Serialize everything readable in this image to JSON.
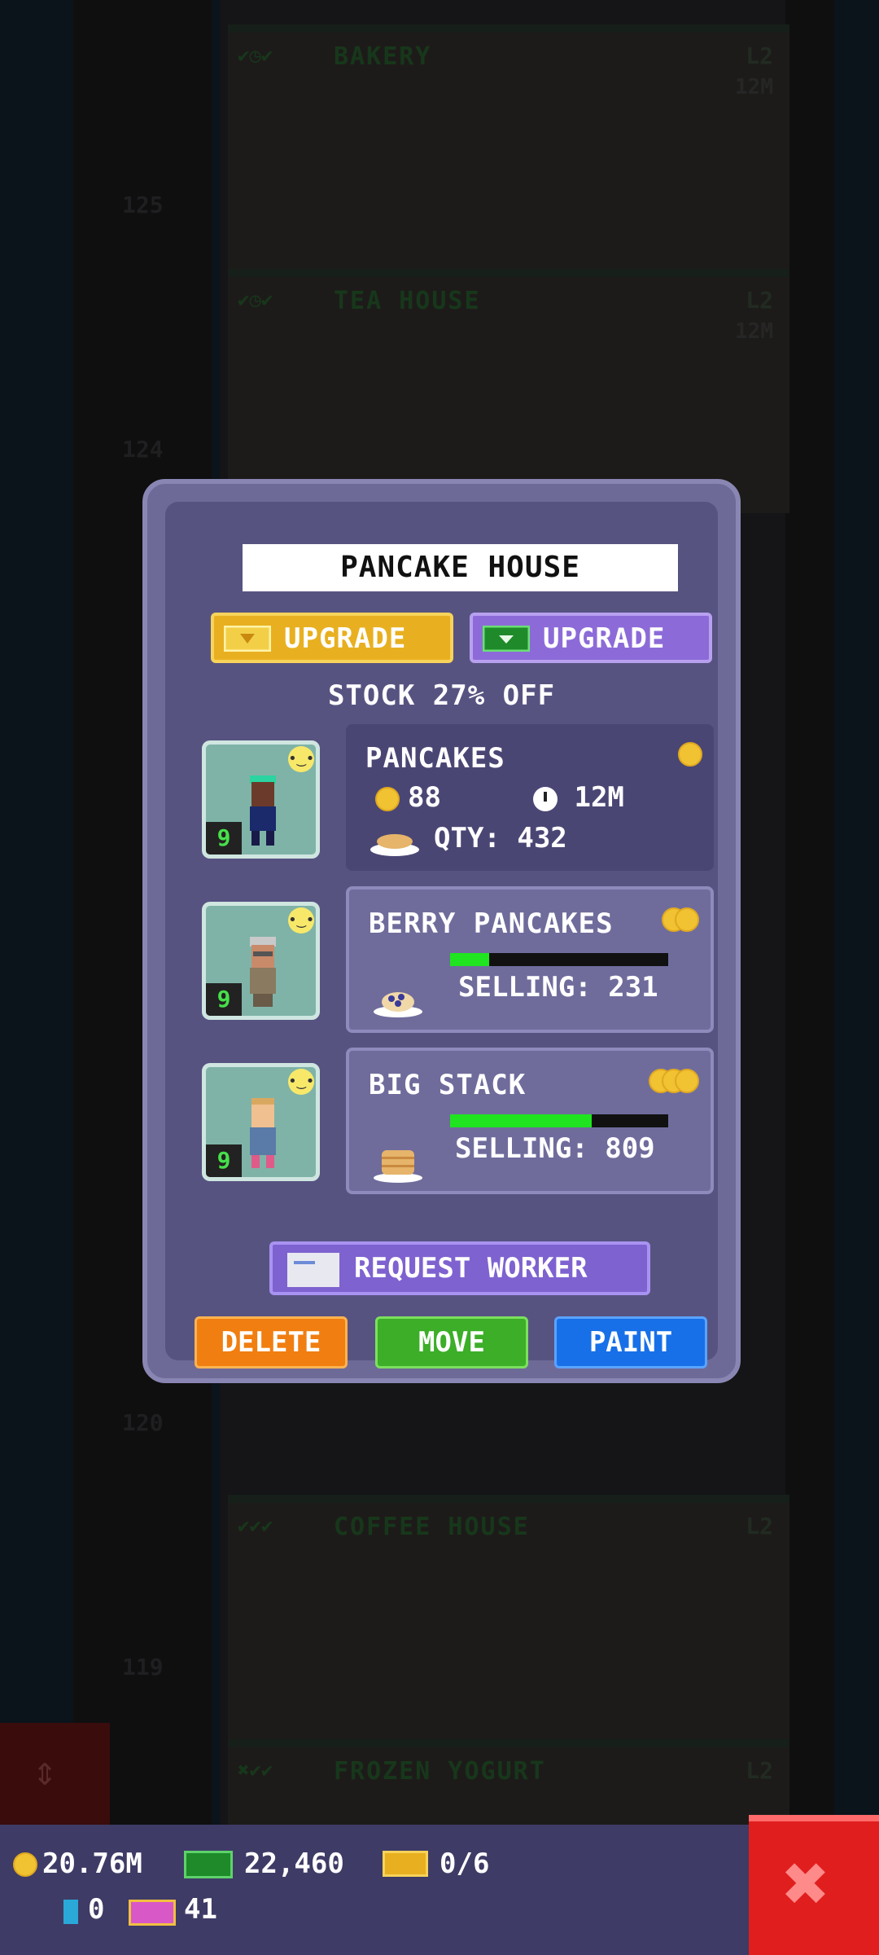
{
  "background": {
    "floors": [
      {
        "name": "BAKERY",
        "level": "L2",
        "time": "12M"
      },
      {
        "name": "TEA HOUSE",
        "level": "L2",
        "time": "12M"
      },
      {
        "name": "COFFEE HOUSE",
        "level": "L2"
      },
      {
        "name": "FROZEN YOGURT",
        "level": "L2"
      }
    ],
    "floor_numbers": [
      "125",
      "124",
      "120",
      "119"
    ]
  },
  "dialog": {
    "title": "PANCAKE HOUSE",
    "upgrade_gold_label": "UPGRADE",
    "upgrade_cash_label": "UPGRADE",
    "stock_text": "STOCK 27% OFF",
    "workers": [
      {
        "level": "9",
        "mood": "neutral"
      },
      {
        "level": "9",
        "mood": "neutral"
      },
      {
        "level": "9",
        "mood": "neutral"
      }
    ],
    "items": [
      {
        "name": "PANCAKES",
        "cost": "88",
        "time": "12M",
        "qty": "QTY: 432",
        "coins": 1
      },
      {
        "name": "BERRY PANCAKES",
        "selling": "SELLING: 231",
        "coins": 2,
        "progress": 0.18
      },
      {
        "name": "BIG STACK",
        "selling": "SELLING: 809",
        "coins": 3,
        "progress": 0.65
      }
    ],
    "request_worker_label": "REQUEST WORKER",
    "delete_label": "DELETE",
    "move_label": "MOVE",
    "paint_label": "PAINT"
  },
  "hud": {
    "coins": "20.76M",
    "cash": "22,460",
    "golden_tickets": "0/6",
    "bux_cards": "0",
    "vip": "41"
  },
  "colors": {
    "dialog_bg": "#575381",
    "gold_button": "#e8b020",
    "cash_button": "#8c6bd8",
    "delete": "#f07e10",
    "move": "#3cae28",
    "paint": "#1870e8",
    "close": "#e01e1e"
  }
}
